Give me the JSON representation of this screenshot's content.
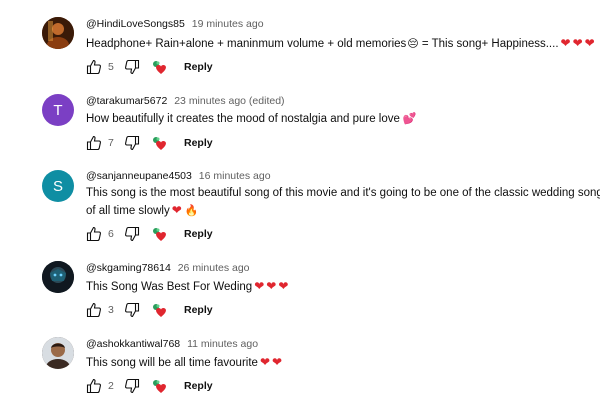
{
  "comments": [
    {
      "author": "@HindiLoveSongs85",
      "time": "19 minutes ago",
      "text": "Headphone+ Rain+alone + maninmum volume + old memories",
      "text_after_emoji": " = This song+ Happiness....",
      "likes": "5",
      "avatar_type": "photo",
      "avatar_color": "#7a3b12"
    },
    {
      "author": "@tarakumar5672",
      "time": "23 minutes ago (edited)",
      "text": "How beautifully it creates the mood of nostalgia and pure love",
      "likes": "7",
      "avatar_letter": "T",
      "avatar_color": "#7b3fc4"
    },
    {
      "author": "@sanjanneupane4503",
      "time": "16 minutes ago",
      "text": "This song is the most beautiful song of this movie and it's going to be one of the classic wedding song",
      "text_line2": "of all time slowly",
      "likes": "6",
      "avatar_letter": "S",
      "avatar_color": "#0f8ea3"
    },
    {
      "author": "@skgaming78614",
      "time": "26 minutes ago",
      "text": "This Song Was Best For Weding",
      "likes": "3",
      "avatar_type": "photo",
      "avatar_color": "#1c2a33"
    },
    {
      "author": "@ashokkantiwal768",
      "time": "11 minutes ago",
      "text": "This song will be all time favourite",
      "likes": "2",
      "avatar_type": "photo",
      "avatar_color": "#4a3a32"
    }
  ],
  "labels": {
    "reply": "Reply"
  },
  "emoji": {
    "heart": "❤",
    "fire": "🔥",
    "kiss": "💕",
    "sob": "😔"
  },
  "colors": {
    "heart_red": "#e0262f",
    "muted_text": "#606060"
  }
}
